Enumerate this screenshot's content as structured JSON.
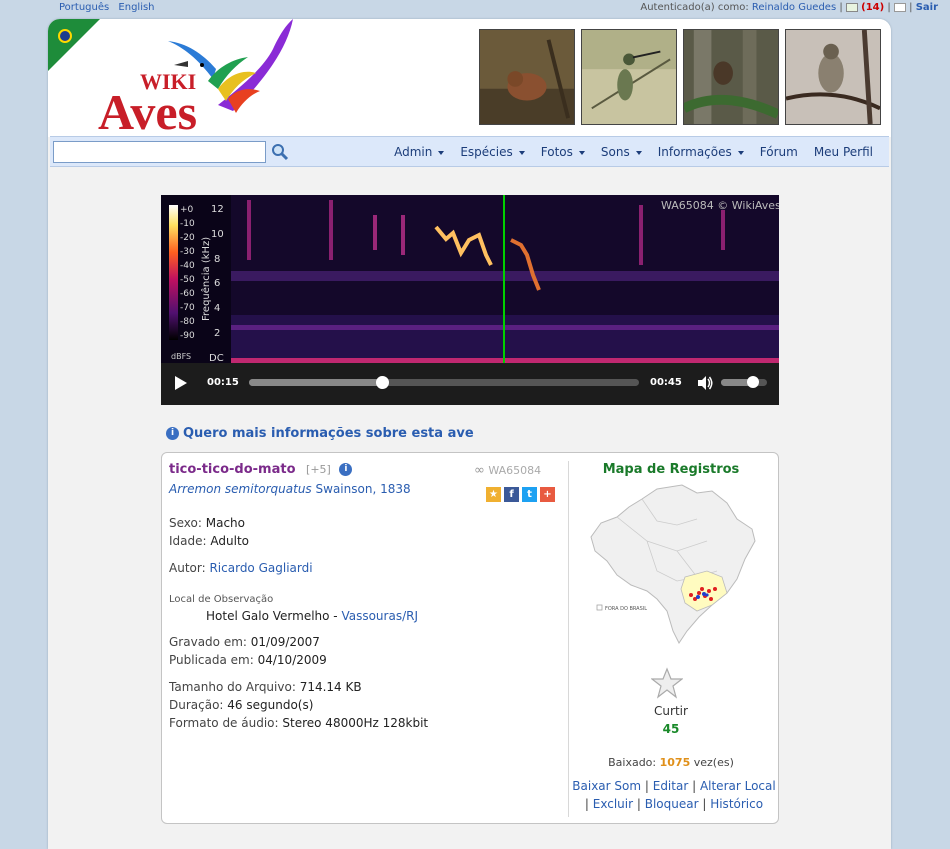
{
  "topbar": {
    "languages": [
      "Português",
      "English"
    ],
    "auth_prefix": "Autenticado(a) como:",
    "user": "Reinaldo Guedes",
    "message_count": "(14)",
    "logout": "Sair"
  },
  "logo": {
    "line1": "WIKI",
    "line2": "Aves"
  },
  "nav": {
    "search_placeholder": "",
    "items": [
      {
        "label": "Admin",
        "dropdown": true
      },
      {
        "label": "Espécies",
        "dropdown": true
      },
      {
        "label": "Fotos",
        "dropdown": true
      },
      {
        "label": "Sons",
        "dropdown": true
      },
      {
        "label": "Informações",
        "dropdown": true
      },
      {
        "label": "Fórum",
        "dropdown": false
      },
      {
        "label": "Meu Perfil",
        "dropdown": false
      }
    ]
  },
  "player": {
    "caption": "WA65084 © WikiAves",
    "y_axis_label": "Frequência (kHz)",
    "y_ticks": [
      "12",
      "10",
      "8",
      "6",
      "4",
      "2",
      "DC"
    ],
    "db_ticks": [
      "+0",
      "-10",
      "-20",
      "-30",
      "-40",
      "-50",
      "-60",
      "-70",
      "-80",
      "-90"
    ],
    "db_unit": "dBFS",
    "current_time": "00:15",
    "total_time": "00:45",
    "progress": 0.34,
    "volume": 0.7
  },
  "more_info": "Quero mais informações sobre esta ave",
  "record": {
    "common_name": "tico-tico-do-mato",
    "extra_count": "[+5]",
    "scientific_name": "Arremon semitorquatus",
    "author_year": "Swainson, 1838",
    "code": "WA65084",
    "sex_label": "Sexo:",
    "sex": "Macho",
    "age_label": "Idade:",
    "age": "Adulto",
    "author_label": "Autor:",
    "author": "Ricardo Gagliardi",
    "location_label": "Local de Observação",
    "location_place": "Hotel Galo Vermelho -",
    "location_city": "Vassouras/RJ",
    "recorded_label": "Gravado em:",
    "recorded": "01/09/2007",
    "published_label": "Publicada em:",
    "published": "04/10/2009",
    "size_label": "Tamanho do Arquivo:",
    "size": "714.14 KB",
    "duration_label": "Duração:",
    "duration": "46 segundo(s)",
    "format_label": "Formato de áudio:",
    "format": "Stereo 48000Hz 128kbit"
  },
  "map": {
    "title": "Mapa de Registros",
    "outside_label": "FORA DO BRASIL"
  },
  "like": {
    "label": "Curtir",
    "count": "45"
  },
  "download": {
    "prefix": "Baixado:",
    "count": "1075",
    "suffix": "vez(es)"
  },
  "actions": [
    "Baixar Som",
    "Editar",
    "Alterar Local",
    "Excluir",
    "Bloquear",
    "Histórico"
  ],
  "colors": {
    "link": "#2a5db0",
    "common_name": "#7b2a8a",
    "map_title": "#1a7a2a",
    "green_marker": "#00d000"
  }
}
